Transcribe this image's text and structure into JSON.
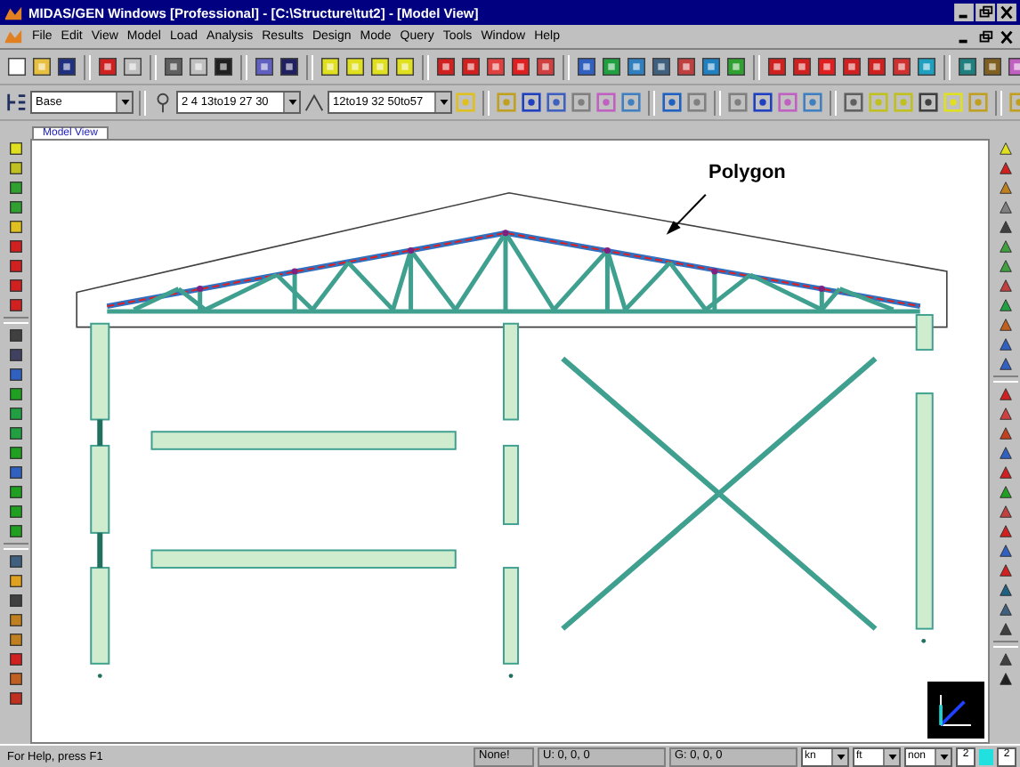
{
  "window": {
    "title": "MIDAS/GEN Windows [Professional] - [C:\\Structure\\tut2] - [Model View]"
  },
  "menu": [
    "File",
    "Edit",
    "View",
    "Model",
    "Load",
    "Analysis",
    "Results",
    "Design",
    "Mode",
    "Query",
    "Tools",
    "Window",
    "Help"
  ],
  "toolbar": {
    "combos": [
      {
        "value": "Base"
      },
      {
        "value": "2 4 13to19 27 30"
      },
      {
        "value": "12to19 32 50to57"
      }
    ]
  },
  "tabs": [
    {
      "label": "Model View",
      "selected": true
    }
  ],
  "canvas": {
    "callout": "Polygon"
  },
  "status_bar": {
    "help": "For Help, press F1",
    "selection": "None!",
    "u_coords": "U: 0, 0, 0",
    "g_coords": "G: 0, 0, 0",
    "force_unit": "kn",
    "length_unit": "ft",
    "mode": "non",
    "field_1": "2",
    "field_2": "2"
  }
}
